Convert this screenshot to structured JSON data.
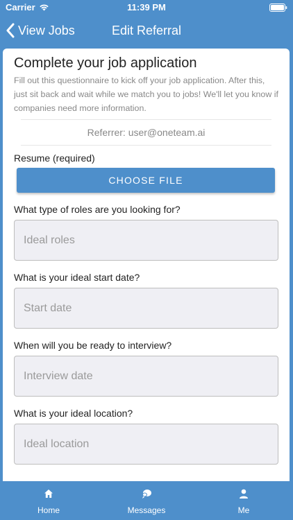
{
  "status": {
    "carrier": "Carrier",
    "time": "11:39 PM"
  },
  "nav": {
    "back_label": "View Jobs",
    "title": "Edit Referral"
  },
  "card": {
    "title": "Complete your job application",
    "description": "Fill out this questionnaire to kick off your job application. After this, just sit back and wait while we match you to jobs! We'll let you know if companies need more information.",
    "referrer": "Referrer: user@oneteam.ai"
  },
  "resume": {
    "label": "Resume (required)",
    "button_label": "CHOOSE FILE"
  },
  "questions": [
    {
      "label": "What type of roles are you looking for?",
      "placeholder": "Ideal roles",
      "value": ""
    },
    {
      "label": "What is your ideal start date?",
      "placeholder": "Start date",
      "value": ""
    },
    {
      "label": "When will you be ready to interview?",
      "placeholder": "Interview date",
      "value": ""
    },
    {
      "label": "What is your ideal location?",
      "placeholder": "Ideal location",
      "value": ""
    }
  ],
  "tabs": [
    {
      "label": "Home",
      "icon": "home-icon"
    },
    {
      "label": "Messages",
      "icon": "messages-icon"
    },
    {
      "label": "Me",
      "icon": "person-icon"
    }
  ],
  "colors": {
    "primary": "#4e8fcb",
    "input_bg": "#efeff4",
    "muted_text": "#888888"
  }
}
